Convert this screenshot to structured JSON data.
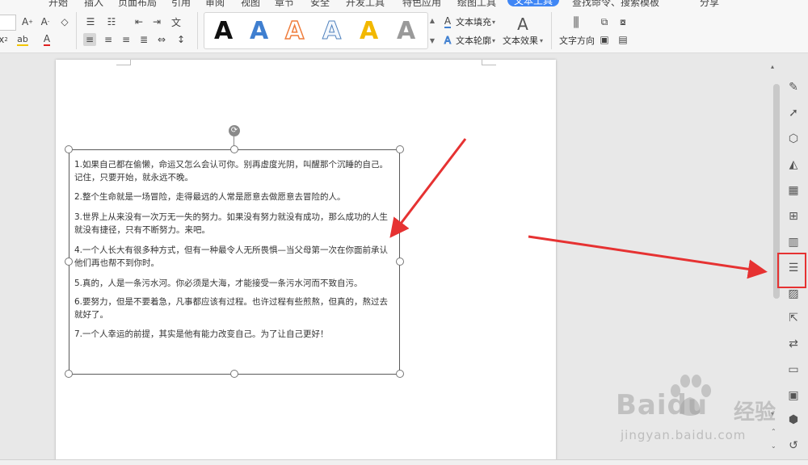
{
  "menu_tabs": [
    "开始",
    "插入",
    "页面布局",
    "引用",
    "审阅",
    "视图",
    "章节",
    "安全",
    "开发工具",
    "特色应用",
    "绘图工具",
    "文本工具"
  ],
  "active_tab": "文本工具",
  "search_label": "查找命令、搜索模板",
  "share_label": "分享",
  "ribbon": {
    "style_letters": [
      {
        "char": "A",
        "color": "#111111",
        "style": "solid"
      },
      {
        "char": "A",
        "color": "#3f7fd0",
        "style": "solid"
      },
      {
        "char": "A",
        "color": "#ef7d3c",
        "style": "outline"
      },
      {
        "char": "A",
        "color": "#4f81bd",
        "style": "outline-light"
      },
      {
        "char": "A",
        "color": "#f2b800",
        "style": "solid"
      },
      {
        "char": "A",
        "color": "#9a9a9a",
        "style": "gradient"
      }
    ],
    "text_fill": "文本填充",
    "text_outline": "文本轮廓",
    "text_effect": "文本效果",
    "text_direction": "文字方向"
  },
  "textbox": {
    "paragraphs": [
      "1.如果自己都在偷懒，命运又怎么会认可你。别再虚度光阴，叫醒那个沉睡的自己。记住，只要开始，就永远不晚。",
      "2.整个生命就是一场冒险，走得最远的人常是愿意去做愿意去冒险的人。",
      "3.世界上从来没有一次万无一失的努力。如果没有努力就没有成功，那么成功的人生就没有捷径，只有不断努力。来吧。",
      "4.一个人长大有很多种方式，但有一种最令人无所畏惧—当父母第一次在你面前承认他们再也帮不到你时。",
      "5.真的，人是一条污水河。你必须是大海，才能接受一条污水河而不致自污。",
      "6.要努力，但是不要着急，凡事都应该有过程。也许过程有些煎熬，但真的，熬过去就好了。",
      "7.一个人幸运的前提，其实是他有能力改变自己。为了让自己更好！"
    ]
  },
  "side_panel_icons": [
    "pen-icon",
    "pointer-icon",
    "shapes-icon",
    "fill-icon",
    "table-icon",
    "grid-icon",
    "chart-icon",
    "properties-icon",
    "image-icon",
    "share-icon",
    "translate-icon",
    "archive-icon",
    "picture-icon",
    "shield-icon",
    "history-icon"
  ],
  "watermark": {
    "logo": "Baidu",
    "cn": "经验",
    "url": "jingyan.baidu.com"
  },
  "colors": {
    "accent": "#3f86f5",
    "annotation_red": "#e63232"
  }
}
